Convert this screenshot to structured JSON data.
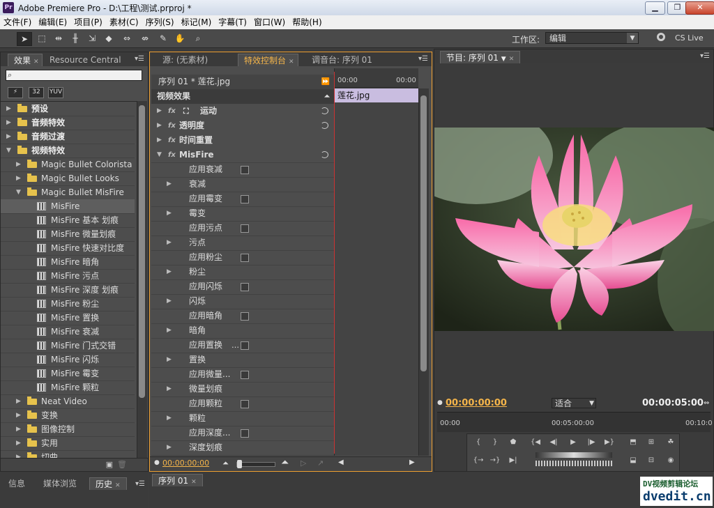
{
  "window": {
    "title": "Adobe Premiere Pro - D:\\工程\\测试.prproj *",
    "logo": "Pr"
  },
  "menu": [
    "文件(F)",
    "编辑(E)",
    "项目(P)",
    "素材(C)",
    "序列(S)",
    "标记(M)",
    "字幕(T)",
    "窗口(W)",
    "帮助(H)"
  ],
  "toolbar": {
    "workspace_label": "工作区:",
    "workspace_value": "编辑",
    "cs_live": "CS Live"
  },
  "effects_panel": {
    "tabs": [
      "效果",
      "Resource Central"
    ],
    "format_buttons": [
      "32",
      "YUV"
    ],
    "tree": [
      {
        "label": "预设",
        "level": 0,
        "type": "folder",
        "bold": true
      },
      {
        "label": "音频特效",
        "level": 0,
        "type": "folder",
        "bold": true
      },
      {
        "label": "音频过渡",
        "level": 0,
        "type": "folder",
        "bold": true
      },
      {
        "label": "视频特效",
        "level": 0,
        "type": "folder",
        "bold": true,
        "open": true
      },
      {
        "label": "Magic Bullet Colorista",
        "level": 1,
        "type": "folder"
      },
      {
        "label": "Magic Bullet Looks",
        "level": 1,
        "type": "folder"
      },
      {
        "label": "Magic Bullet MisFire",
        "level": 1,
        "type": "folder",
        "open": true
      },
      {
        "label": "MisFire",
        "level": 2,
        "type": "fx",
        "selected": true
      },
      {
        "label": "MisFire 基本  划痕",
        "level": 2,
        "type": "fx"
      },
      {
        "label": "MisFire 微量划痕",
        "level": 2,
        "type": "fx"
      },
      {
        "label": "MisFire 快速对比度",
        "level": 2,
        "type": "fx"
      },
      {
        "label": "MisFire 暗角",
        "level": 2,
        "type": "fx"
      },
      {
        "label": "MisFire 污点",
        "level": 2,
        "type": "fx"
      },
      {
        "label": "MisFire 深度  划痕",
        "level": 2,
        "type": "fx"
      },
      {
        "label": "MisFire 粉尘",
        "level": 2,
        "type": "fx"
      },
      {
        "label": "MisFire 置换",
        "level": 2,
        "type": "fx"
      },
      {
        "label": "MisFire 衰减",
        "level": 2,
        "type": "fx"
      },
      {
        "label": "MisFire 门式交错",
        "level": 2,
        "type": "fx"
      },
      {
        "label": "MisFire 闪烁",
        "level": 2,
        "type": "fx"
      },
      {
        "label": "MisFire 霉变",
        "level": 2,
        "type": "fx"
      },
      {
        "label": "MisFire 颗粒",
        "level": 2,
        "type": "fx"
      },
      {
        "label": "Neat Video",
        "level": 1,
        "type": "folder"
      },
      {
        "label": "变换",
        "level": 1,
        "type": "folder"
      },
      {
        "label": "图像控制",
        "level": 1,
        "type": "folder"
      },
      {
        "label": "实用",
        "level": 1,
        "type": "folder"
      },
      {
        "label": "切曲",
        "level": 1,
        "type": "folder"
      }
    ]
  },
  "effect_controls": {
    "tabs": [
      "源: (无素材)",
      "特效控制台",
      "调音台: 序列 01"
    ],
    "clip_header": "序列 01 * 莲花.jpg",
    "section": "视频效果",
    "ruler_left": "00:00",
    "ruler_right": "00:00",
    "clip_name": "莲花.jpg",
    "rows": [
      {
        "label": "运动",
        "kind": "effect",
        "reset": true
      },
      {
        "label": "透明度",
        "kind": "effect",
        "reset": true
      },
      {
        "label": "时间重置",
        "kind": "effect",
        "reset": false
      },
      {
        "label": "MisFire",
        "kind": "effect",
        "reset": true,
        "open": true
      },
      {
        "label": "应用衰减",
        "kind": "checkbox"
      },
      {
        "label": "衰减",
        "kind": "group"
      },
      {
        "label": "应用霉变",
        "kind": "checkbox"
      },
      {
        "label": "霉变",
        "kind": "group"
      },
      {
        "label": "应用污点",
        "kind": "checkbox"
      },
      {
        "label": "污点",
        "kind": "group"
      },
      {
        "label": "应用粉尘",
        "kind": "checkbox"
      },
      {
        "label": "粉尘",
        "kind": "group"
      },
      {
        "label": "应用闪烁",
        "kind": "checkbox"
      },
      {
        "label": "闪烁",
        "kind": "group"
      },
      {
        "label": "应用暗角",
        "kind": "checkbox"
      },
      {
        "label": "暗角",
        "kind": "group"
      },
      {
        "label": "应用置换",
        "kind": "checkbox",
        "ellipsis": true
      },
      {
        "label": "置换",
        "kind": "group"
      },
      {
        "label": "应用微量...",
        "kind": "checkbox"
      },
      {
        "label": "微量划痕",
        "kind": "group"
      },
      {
        "label": "应用颗粒",
        "kind": "checkbox"
      },
      {
        "label": "颗粒",
        "kind": "group"
      },
      {
        "label": "应用深度...",
        "kind": "checkbox"
      },
      {
        "label": "深度划痕",
        "kind": "group"
      }
    ],
    "timecode": "00:00:00:00"
  },
  "program_monitor": {
    "tab": "节目: 序列 01",
    "current_time": "00:00:00:00",
    "zoom": "适合",
    "duration": "00:00:05:00",
    "ruler": [
      "00:00",
      "00:05:00:00",
      "00:10:0"
    ]
  },
  "bottom_panels": {
    "left_tabs": [
      "信息",
      "媒体浏览",
      "历史"
    ],
    "timeline_tab": "序列 01"
  },
  "watermark": {
    "line1": "DV视频剪辑论坛",
    "line2": "dvedit.cn"
  },
  "colors": {
    "accent": "#f0a030",
    "timecode": "#f5b54a",
    "panel": "#4d4d4d",
    "clip": "#c9bde0"
  }
}
